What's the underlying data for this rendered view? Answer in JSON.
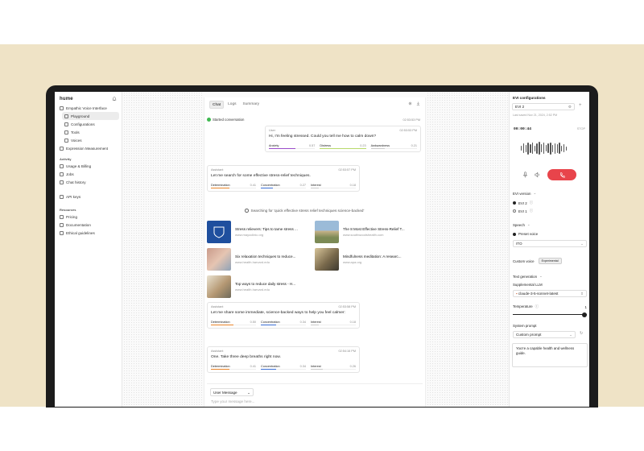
{
  "sidebar": {
    "logo": "hume",
    "items": [
      {
        "label": "Empathic Voice Interface",
        "level": 0
      },
      {
        "label": "Playground",
        "level": 1,
        "active": true
      },
      {
        "label": "Configurations",
        "level": 1
      },
      {
        "label": "Tools",
        "level": 1
      },
      {
        "label": "Voices",
        "level": 1
      },
      {
        "label": "Expression Measurement",
        "level": 0
      }
    ],
    "activity_title": "Activity",
    "activity_items": [
      "Usage & Billing",
      "Jobs",
      "Chat history"
    ],
    "api_keys": "API keys",
    "resources_title": "Resources",
    "resources_items": [
      "Pricing",
      "Documentation",
      "Ethical guidelines"
    ]
  },
  "chat": {
    "tabs": [
      "Chat",
      "Logs",
      "Summary"
    ],
    "started": "Started conversation",
    "started_time": "02:53:53 PM",
    "messages": [
      {
        "role": "User",
        "time": "02:53:53 PM",
        "text": "Hi, I'm feeling stressed. Could you tell me how to calm down?",
        "emotions": [
          {
            "name": "Anxiety",
            "value": "0.57"
          },
          {
            "name": "Distress",
            "value": "0.23"
          },
          {
            "name": "Awkwardness",
            "value": "0.21"
          }
        ]
      },
      {
        "role": "Assistant",
        "time": "02:53:57 PM",
        "text": "Let me search for some effective stress-relief techniques.",
        "emotions": [
          {
            "name": "Determination",
            "value": "0.41"
          },
          {
            "name": "Concentration",
            "value": "0.27"
          },
          {
            "name": "Interest",
            "value": "0.18"
          }
        ]
      },
      {
        "role": "Assistant",
        "time": "02:53:58 PM",
        "text": "Let me share some immediate, science-backed ways to help you feel calmer:",
        "emotions": [
          {
            "name": "Determination",
            "value": "0.50"
          },
          {
            "name": "Concentration",
            "value": "0.34"
          },
          {
            "name": "Interest",
            "value": "0.18"
          }
        ]
      },
      {
        "role": "Assistant",
        "time": "02:54:16 PM",
        "text": "One. Take three deep breaths right now.",
        "emotions": [
          {
            "name": "Determination",
            "value": "0.41"
          },
          {
            "name": "Concentration",
            "value": "0.34"
          },
          {
            "name": "Interest",
            "value": "0.26"
          }
        ]
      }
    ],
    "search_query": "Searching for 'quick effective stress relief techniques science-backed'",
    "results": [
      {
        "title": "Stress relievers: Tips to tame stress ...",
        "url": "www.mayoclinic.org"
      },
      {
        "title": "The 8 Most Effective Stress-Relief T...",
        "url": "www.southwoodshealth.com"
      },
      {
        "title": "Six relaxation techniques to reduce...",
        "url": "www.health.harvard.edu"
      },
      {
        "title": "Mindfulness meditation: A researc...",
        "url": "www.apa.org"
      },
      {
        "title": "Top ways to reduce daily stress - H...",
        "url": "www.health.harvard.edu"
      }
    ],
    "role_select": "User Message",
    "placeholder": "Type your message here..."
  },
  "config": {
    "title": "EVI configurations",
    "selected": "EVI 2",
    "last_saved": "Last saved Nov 21, 2024, 2:52 PM",
    "timer": "00:00:44",
    "stop": "STOP",
    "evi_version_title": "EVI version",
    "evi_options": [
      "EVI 2",
      "EVI 1"
    ],
    "speech_title": "Speech",
    "preset_voice": "Preset voice",
    "voice": "ITO",
    "custom_voice": "Custom voice",
    "experimental": "Experimental",
    "text_gen_title": "Text generation",
    "supplemental_llm": "Supplemental LLM",
    "llm": "claude-3-5-sonnet-latest",
    "temperature_label": "Temperature",
    "temperature_value": "1",
    "system_prompt_label": "System prompt",
    "prompt_select": "Custom prompt",
    "prompt_text": "You're a capable health and wellness guide."
  },
  "colors": {
    "accent_red": "#e8444b",
    "green": "#3fb950",
    "emotion_colors": [
      "#9b4dca",
      "#b8d96b",
      "#c9c9c9",
      "#e8852b",
      "#3b6fd4",
      "#c9c9c9"
    ]
  }
}
